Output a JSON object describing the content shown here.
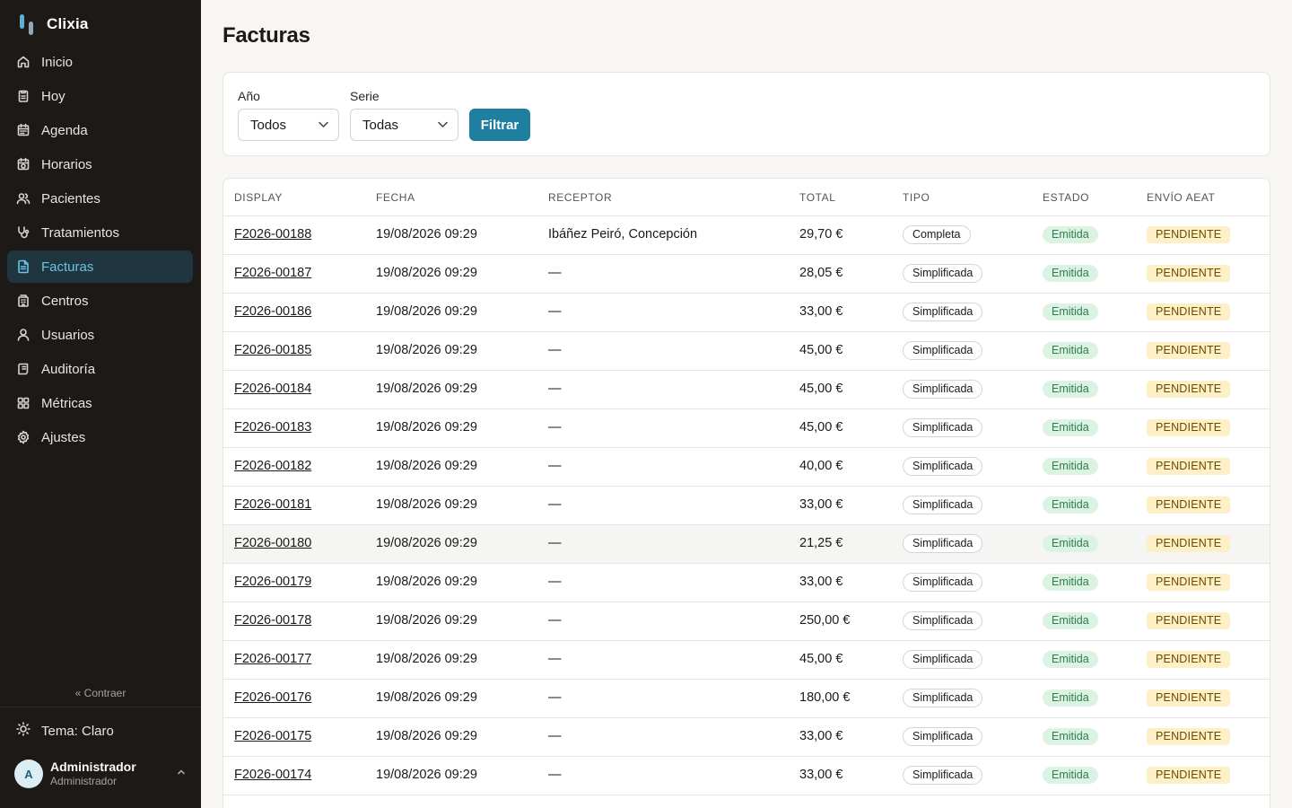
{
  "app": {
    "name": "Clixia"
  },
  "sidebar": {
    "items": [
      {
        "label": "Inicio",
        "icon": "home-icon"
      },
      {
        "label": "Hoy",
        "icon": "clipboard-icon"
      },
      {
        "label": "Agenda",
        "icon": "calendar-icon"
      },
      {
        "label": "Horarios",
        "icon": "calendar-clock-icon"
      },
      {
        "label": "Pacientes",
        "icon": "users-icon"
      },
      {
        "label": "Tratamientos",
        "icon": "stethoscope-icon"
      },
      {
        "label": "Facturas",
        "icon": "file-text-icon",
        "active": true
      },
      {
        "label": "Centros",
        "icon": "building-icon"
      },
      {
        "label": "Usuarios",
        "icon": "user-icon"
      },
      {
        "label": "Auditoría",
        "icon": "scroll-icon"
      },
      {
        "label": "Métricas",
        "icon": "grid-icon"
      },
      {
        "label": "Ajustes",
        "icon": "gear-icon"
      }
    ],
    "collapse_label": "« Contraer",
    "theme_label": "Tema: Claro",
    "user": {
      "initial": "A",
      "name": "Administrador",
      "role": "Administrador"
    }
  },
  "page": {
    "title": "Facturas"
  },
  "filters": {
    "year_label": "Año",
    "year_value": "Todos",
    "series_label": "Serie",
    "series_value": "Todas",
    "submit_label": "Filtrar"
  },
  "table": {
    "columns": [
      "Display",
      "Fecha",
      "Receptor",
      "Total",
      "Tipo",
      "Estado",
      "Envío AEAT"
    ],
    "rows": [
      {
        "display": "F2026-00188",
        "fecha": "19/08/2026 09:29",
        "receptor": "Ibáñez Peiró, Concepción",
        "total": "29,70 €",
        "tipo": "Completa",
        "estado": "Emitida",
        "aeat": "PENDIENTE"
      },
      {
        "display": "F2026-00187",
        "fecha": "19/08/2026 09:29",
        "receptor": "—",
        "total": "28,05 €",
        "tipo": "Simplificada",
        "estado": "Emitida",
        "aeat": "PENDIENTE"
      },
      {
        "display": "F2026-00186",
        "fecha": "19/08/2026 09:29",
        "receptor": "—",
        "total": "33,00 €",
        "tipo": "Simplificada",
        "estado": "Emitida",
        "aeat": "PENDIENTE"
      },
      {
        "display": "F2026-00185",
        "fecha": "19/08/2026 09:29",
        "receptor": "—",
        "total": "45,00 €",
        "tipo": "Simplificada",
        "estado": "Emitida",
        "aeat": "PENDIENTE"
      },
      {
        "display": "F2026-00184",
        "fecha": "19/08/2026 09:29",
        "receptor": "—",
        "total": "45,00 €",
        "tipo": "Simplificada",
        "estado": "Emitida",
        "aeat": "PENDIENTE"
      },
      {
        "display": "F2026-00183",
        "fecha": "19/08/2026 09:29",
        "receptor": "—",
        "total": "45,00 €",
        "tipo": "Simplificada",
        "estado": "Emitida",
        "aeat": "PENDIENTE"
      },
      {
        "display": "F2026-00182",
        "fecha": "19/08/2026 09:29",
        "receptor": "—",
        "total": "40,00 €",
        "tipo": "Simplificada",
        "estado": "Emitida",
        "aeat": "PENDIENTE"
      },
      {
        "display": "F2026-00181",
        "fecha": "19/08/2026 09:29",
        "receptor": "—",
        "total": "33,00 €",
        "tipo": "Simplificada",
        "estado": "Emitida",
        "aeat": "PENDIENTE"
      },
      {
        "display": "F2026-00180",
        "fecha": "19/08/2026 09:29",
        "receptor": "—",
        "total": "21,25 €",
        "tipo": "Simplificada",
        "estado": "Emitida",
        "aeat": "PENDIENTE",
        "hover": true
      },
      {
        "display": "F2026-00179",
        "fecha": "19/08/2026 09:29",
        "receptor": "—",
        "total": "33,00 €",
        "tipo": "Simplificada",
        "estado": "Emitida",
        "aeat": "PENDIENTE"
      },
      {
        "display": "F2026-00178",
        "fecha": "19/08/2026 09:29",
        "receptor": "—",
        "total": "250,00 €",
        "tipo": "Simplificada",
        "estado": "Emitida",
        "aeat": "PENDIENTE"
      },
      {
        "display": "F2026-00177",
        "fecha": "19/08/2026 09:29",
        "receptor": "—",
        "total": "45,00 €",
        "tipo": "Simplificada",
        "estado": "Emitida",
        "aeat": "PENDIENTE"
      },
      {
        "display": "F2026-00176",
        "fecha": "19/08/2026 09:29",
        "receptor": "—",
        "total": "180,00 €",
        "tipo": "Simplificada",
        "estado": "Emitida",
        "aeat": "PENDIENTE"
      },
      {
        "display": "F2026-00175",
        "fecha": "19/08/2026 09:29",
        "receptor": "—",
        "total": "33,00 €",
        "tipo": "Simplificada",
        "estado": "Emitida",
        "aeat": "PENDIENTE"
      },
      {
        "display": "F2026-00174",
        "fecha": "19/08/2026 09:29",
        "receptor": "—",
        "total": "33,00 €",
        "tipo": "Simplificada",
        "estado": "Emitida",
        "aeat": "PENDIENTE"
      }
    ]
  }
}
